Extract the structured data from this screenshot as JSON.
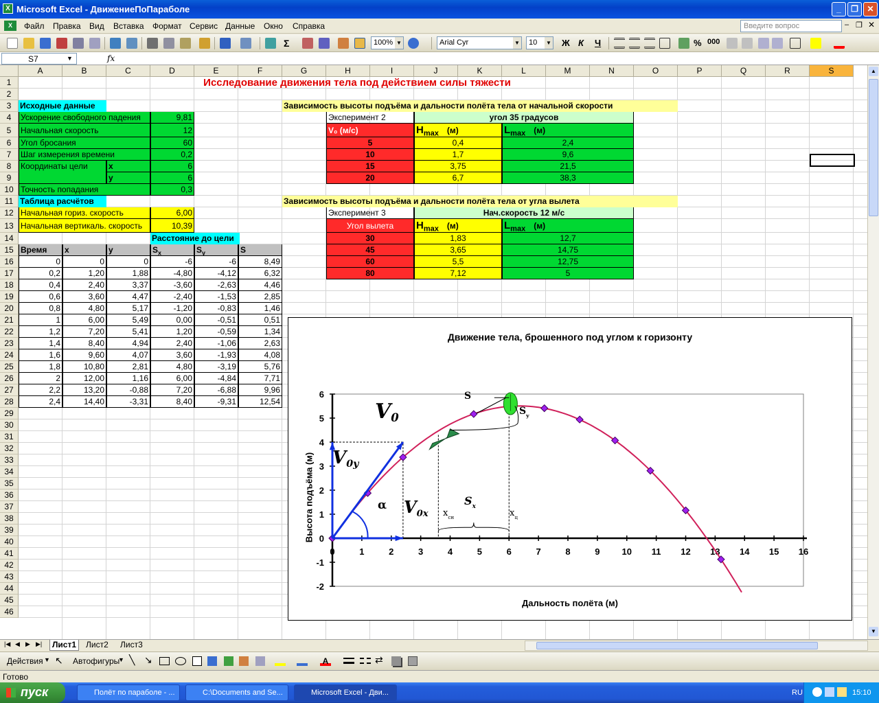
{
  "window": {
    "title": "Microsoft Excel - ДвижениеПоПараболе"
  },
  "menu": [
    "Файл",
    "Правка",
    "Вид",
    "Вставка",
    "Формат",
    "Сервис",
    "Данные",
    "Окно",
    "Справка"
  ],
  "ask_placeholder": "Введите вопрос",
  "toolbar": {
    "zoom": "100%",
    "font": "Arial Cyr",
    "size": "10",
    "bold": "Ж",
    "italic": "К",
    "underline": "Ч",
    "percent": "%",
    "thousands": "000"
  },
  "formula_bar": {
    "name_box": "S7",
    "fx": "fx",
    "content": ""
  },
  "columns": [
    "A",
    "B",
    "C",
    "D",
    "E",
    "F",
    "G",
    "H",
    "I",
    "J",
    "K",
    "L",
    "M",
    "N",
    "O",
    "P",
    "Q",
    "R",
    "S"
  ],
  "selected_column": "S",
  "rows": [
    "1",
    "2",
    "3",
    "4",
    "5",
    "6",
    "7",
    "8",
    "9",
    "10",
    "11",
    "12",
    "13",
    "14",
    "15",
    "16",
    "17",
    "18",
    "19",
    "20",
    "21",
    "22",
    "23",
    "24",
    "25",
    "26",
    "27",
    "28",
    "29",
    "30",
    "31",
    "32",
    "33",
    "34",
    "35",
    "36",
    "37",
    "38",
    "39",
    "40",
    "41",
    "42",
    "43",
    "44",
    "45",
    "46"
  ],
  "sheet": {
    "main_title": "Исследование движения тела под действием силы тяжести",
    "inputs_header": "Исходные данные",
    "inputs": [
      {
        "label": "Ускорение свободного падения",
        "value": "9,81"
      },
      {
        "label": "Начальная скорость",
        "value": "12"
      },
      {
        "label": "Угол бросания",
        "value": "60"
      },
      {
        "label": "Шаг измерения времени",
        "value": "0,2"
      }
    ],
    "target": {
      "label": "Координаты цели",
      "x_label": "x",
      "x": "6",
      "y_label": "y",
      "y": "6"
    },
    "accuracy": {
      "label": "Точность попадания",
      "value": "0,3"
    },
    "calc_header": "Таблица расчётов",
    "vx": {
      "label": "Начальная гориз. скорость",
      "value": "6,00"
    },
    "vy": {
      "label": "Начальная вертикаль. скорость",
      "value": "10,39"
    },
    "dist_header": "Расстояние до цели",
    "table_headers": [
      "Время",
      "x",
      "y",
      "S",
      "S",
      "S"
    ],
    "table_header_subs": [
      "",
      "",
      "",
      "x",
      "y",
      ""
    ],
    "table_rows": [
      [
        "0",
        "0",
        "0",
        "-6",
        "-6",
        "8,49"
      ],
      [
        "0,2",
        "1,20",
        "1,88",
        "-4,80",
        "-4,12",
        "6,32"
      ],
      [
        "0,4",
        "2,40",
        "3,37",
        "-3,60",
        "-2,63",
        "4,46"
      ],
      [
        "0,6",
        "3,60",
        "4,47",
        "-2,40",
        "-1,53",
        "2,85"
      ],
      [
        "0,8",
        "4,80",
        "5,17",
        "-1,20",
        "-0,83",
        "1,46"
      ],
      [
        "1",
        "6,00",
        "5,49",
        "0,00",
        "-0,51",
        "0,51"
      ],
      [
        "1,2",
        "7,20",
        "5,41",
        "1,20",
        "-0,59",
        "1,34"
      ],
      [
        "1,4",
        "8,40",
        "4,94",
        "2,40",
        "-1,06",
        "2,63"
      ],
      [
        "1,6",
        "9,60",
        "4,07",
        "3,60",
        "-1,93",
        "4,08"
      ],
      [
        "1,8",
        "10,80",
        "2,81",
        "4,80",
        "-3,19",
        "5,76"
      ],
      [
        "2",
        "12,00",
        "1,16",
        "6,00",
        "-4,84",
        "7,71"
      ],
      [
        "2,2",
        "13,20",
        "-0,88",
        "7,20",
        "-6,88",
        "9,96"
      ],
      [
        "2,4",
        "14,40",
        "-3,31",
        "8,40",
        "-9,31",
        "12,54"
      ]
    ],
    "exp2": {
      "title": "Зависимость высоты подъёма и дальности полёта  тела от начальной скорости",
      "label": "Эксперимент 2",
      "condition": "угол 35 градусов",
      "h1": "V₀ (м/с)",
      "h2_main": "H",
      "h2_sub": "max",
      "h2_unit": "(м)",
      "h3_main": "L",
      "h3_sub": "max",
      "h3_unit": "(м)",
      "rows": [
        [
          "5",
          "0,4",
          "2,4"
        ],
        [
          "10",
          "1,7",
          "9,6"
        ],
        [
          "15",
          "3,75",
          "21,5"
        ],
        [
          "20",
          "6,7",
          "38,3"
        ]
      ]
    },
    "exp3": {
      "title": "Зависимость высоты подъёма и дальности полёта  тела от угла вылета",
      "label": "Эксперимент 3",
      "condition": "Нач.скорость 12 м/с",
      "h1": "Угол вылета",
      "h2_main": "H",
      "h2_sub": "max",
      "h2_unit": "(м)",
      "h3_main": "L",
      "h3_sub": "max",
      "h3_unit": "(м)",
      "rows": [
        [
          "30",
          "1,83",
          "12,7"
        ],
        [
          "45",
          "3,65",
          "14,75"
        ],
        [
          "60",
          "5,5",
          "12,75"
        ],
        [
          "80",
          "7,12",
          "5"
        ]
      ]
    }
  },
  "chart_data": {
    "type": "scatter",
    "title": "Движение тела, брошенного под углом к горизонту",
    "xlabel": "Дальность полёта (м)",
    "ylabel": "Высота подъёма (м)",
    "xlim": [
      0,
      16
    ],
    "ylim": [
      -2,
      6
    ],
    "xticks": [
      "0",
      "1",
      "2",
      "3",
      "4",
      "5",
      "6",
      "7",
      "8",
      "9",
      "10",
      "11",
      "12",
      "13",
      "14",
      "15",
      "16"
    ],
    "yticks": [
      "-2",
      "-1",
      "0",
      "1",
      "2",
      "3",
      "4",
      "5",
      "6"
    ],
    "series": [
      {
        "x": [
          0,
          1.2,
          2.4,
          3.6,
          4.8,
          6.0,
          7.2,
          8.4,
          9.6,
          10.8,
          12.0,
          13.2,
          14.4
        ],
        "y": [
          0,
          1.88,
          3.37,
          4.47,
          5.17,
          5.49,
          5.41,
          4.94,
          4.07,
          2.81,
          1.16,
          -0.88,
          -3.31
        ],
        "markers": [
          0,
          1.2,
          2.4,
          4.8,
          7.2,
          8.4,
          9.6,
          10.8,
          12.0,
          13.2
        ],
        "color": "#d0205a"
      }
    ],
    "annotations": {
      "v0": "V",
      "v0_sub": "0",
      "v0y": "V",
      "v0y_sub": "0y",
      "v0x": "V",
      "v0x_sub": "0x",
      "alpha": "α",
      "s": "S",
      "sy": "S",
      "sy_sub": "y",
      "sx": "S",
      "sx_sub": "x",
      "xsn": "x",
      "xsn_sub": "сн",
      "xc": "x",
      "xc_sub": "ц"
    }
  },
  "sheet_tabs": [
    "Лист1",
    "Лист2",
    "Лист3"
  ],
  "drawing_toolbar": {
    "actions": "Действия",
    "autoshapes": "Автофигуры"
  },
  "status": "Готово",
  "taskbar": {
    "start": "пуск",
    "tasks": [
      "Полёт по параболе - ...",
      "C:\\Documents and Se...",
      "Microsoft Excel - Дви..."
    ],
    "lang": "RU",
    "clock": "15:10"
  }
}
